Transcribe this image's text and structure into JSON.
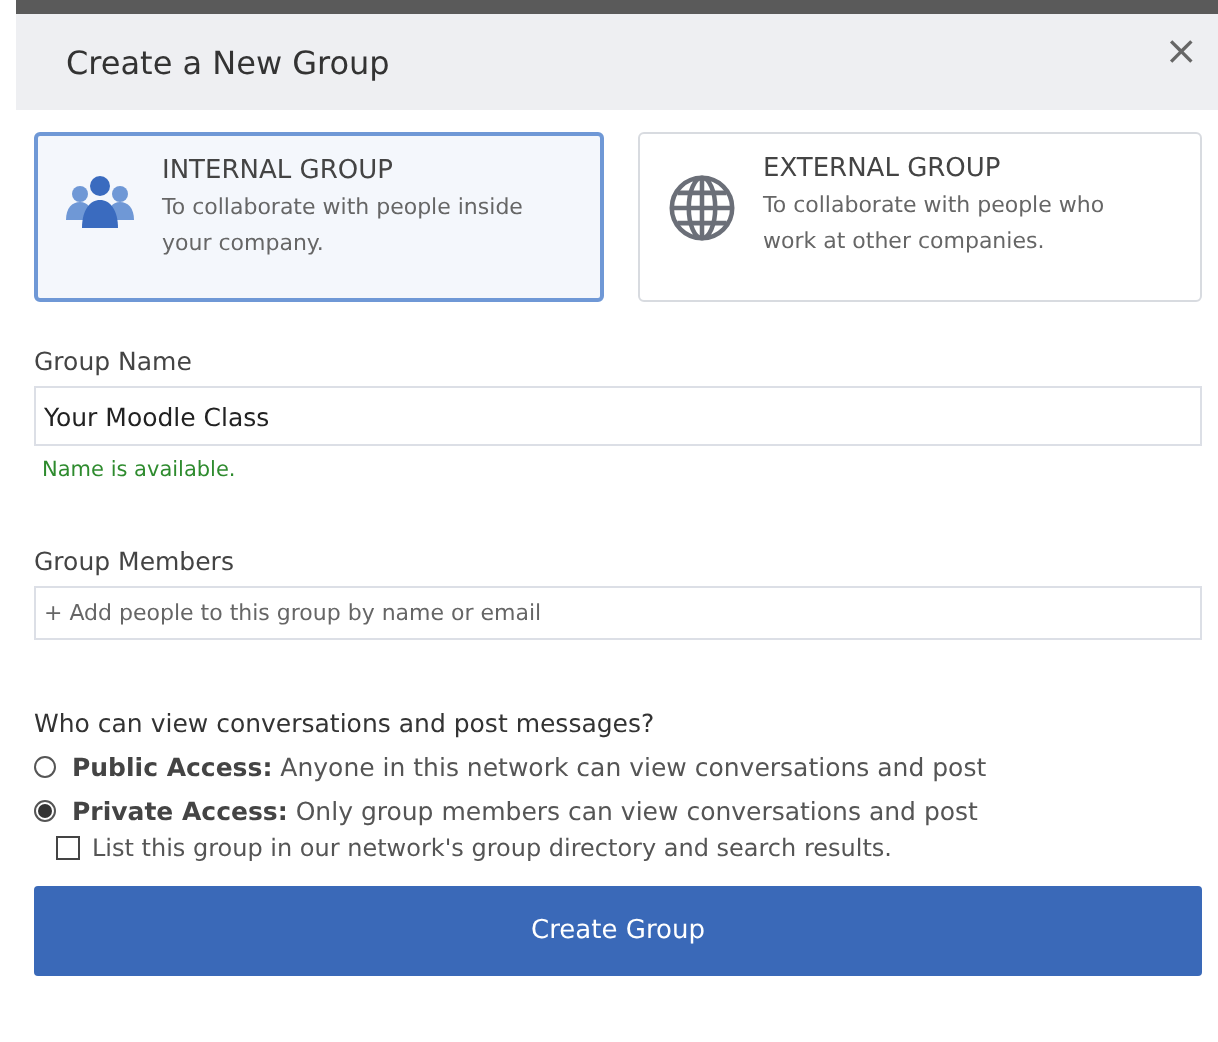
{
  "window": {
    "title": "Create a New Group",
    "close": "×"
  },
  "group_types": [
    {
      "kind": "internal",
      "title": "INTERNAL GROUP",
      "description": "To collaborate with people inside your company.",
      "selected": true
    },
    {
      "kind": "external",
      "title": "EXTERNAL GROUP",
      "description": "To collaborate with people who work at other companies.",
      "selected": false
    }
  ],
  "group_name": {
    "label": "Group Name",
    "value": "Your Moodle Class",
    "status": "Name is available."
  },
  "group_members": {
    "label": "Group Members",
    "placeholder": "+ Add people to this group by name or email"
  },
  "access": {
    "question": "Who can view conversations and post messages?",
    "options": [
      {
        "text": "**Public Access:** Anyone in this network can view conversations and post",
        "selected": false
      },
      {
        "text": "**Private Access:** Only group members can view conversations and post",
        "selected": true
      }
    ],
    "directory": {
      "label": "List this group in our network's group directory and search results.",
      "checked": false
    }
  },
  "submit": "Create Group"
}
